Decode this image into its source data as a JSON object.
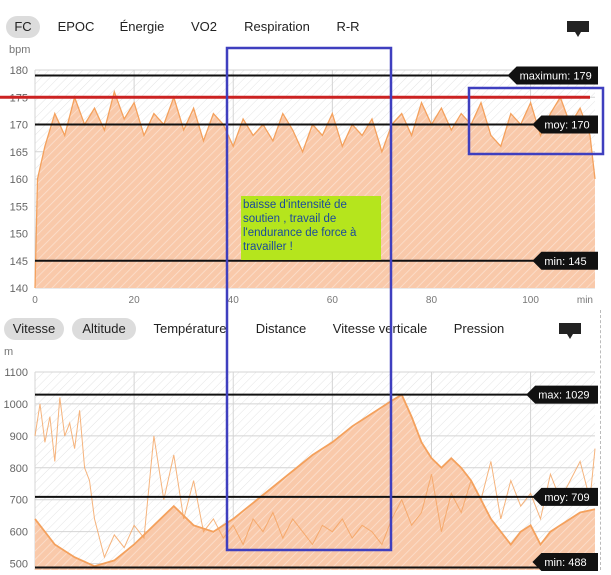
{
  "top_tabs": [
    {
      "label": "FC",
      "active": true
    },
    {
      "label": "EPOC",
      "active": false
    },
    {
      "label": "Énergie",
      "active": false
    },
    {
      "label": "VO2",
      "active": false
    },
    {
      "label": "Respiration",
      "active": false
    },
    {
      "label": "R-R",
      "active": false
    }
  ],
  "bottom_tabs": [
    {
      "label": "Vitesse",
      "active": true
    },
    {
      "label": "Altitude",
      "active": true
    },
    {
      "label": "Température",
      "active": false
    },
    {
      "label": "Distance",
      "active": false
    },
    {
      "label": "Vitesse verticale",
      "active": false
    },
    {
      "label": "Pression",
      "active": false
    }
  ],
  "annotation_note": {
    "lines": [
      "  baisse d'intensité de",
      "soutien ,  travail de",
      "l'endurance de force à",
      "travailler !"
    ]
  },
  "colors": {
    "area_fill": "#f9c9aa",
    "series_line": "#f4a15d",
    "reference_line": "#cc2222",
    "highlight_box": "#3f3fbf",
    "note_bg": "#b5e51d"
  },
  "chart_data": [
    {
      "type": "area",
      "ylabel": "bpm",
      "y_ticks": [
        140,
        145,
        150,
        155,
        160,
        165,
        170,
        175,
        180
      ],
      "x_ticks": [
        "0",
        "20",
        "40",
        "60",
        "80",
        "100"
      ],
      "x_unit": "min",
      "ylim": [
        140,
        180
      ],
      "xlim": [
        0,
        113
      ],
      "grid": true,
      "reference_line": 175,
      "stats": [
        {
          "label": "maximum: 179",
          "value": 179
        },
        {
          "label": "moy: 170",
          "value": 170
        },
        {
          "label": "min: 145",
          "value": 145
        }
      ],
      "series": [
        {
          "x": [
            0,
            0.5,
            2,
            4,
            6,
            8,
            10,
            12,
            14,
            16,
            18,
            20,
            22,
            24,
            26,
            28,
            30,
            32,
            34,
            36,
            38,
            40,
            42,
            44,
            46,
            48,
            50,
            52,
            54,
            56,
            58,
            60,
            62,
            64,
            66,
            68,
            70,
            72,
            74,
            76,
            78,
            80,
            82,
            84,
            86,
            88,
            90,
            92,
            94,
            96,
            98,
            100,
            102,
            104,
            106,
            108,
            110,
            112,
            113
          ],
          "y": [
            140,
            160,
            166,
            172,
            168,
            175,
            170,
            173,
            169,
            176,
            171,
            174,
            168,
            172,
            170,
            175,
            169,
            173,
            167,
            172,
            170,
            166,
            171,
            168,
            170,
            167,
            172,
            169,
            165,
            170,
            168,
            172,
            166,
            170,
            168,
            171,
            165,
            170,
            172,
            168,
            174,
            170,
            173,
            169,
            172,
            170,
            174,
            168,
            166,
            172,
            170,
            174,
            168,
            172,
            175,
            170,
            173,
            168,
            160
          ]
        }
      ]
    },
    {
      "type": "area",
      "ylabel": "m",
      "y_ticks": [
        500,
        600,
        700,
        800,
        900,
        1000,
        1100
      ],
      "ylim": [
        480,
        1100
      ],
      "xlim": [
        0,
        113
      ],
      "grid": true,
      "stats": [
        {
          "label": "max: 1029",
          "value": 1029
        },
        {
          "label": "moy: 709",
          "value": 709
        },
        {
          "label": "min: 488",
          "value": 488
        }
      ],
      "series": [
        {
          "name": "Altitude",
          "x": [
            0,
            4,
            8,
            12,
            16,
            20,
            24,
            28,
            32,
            36,
            40,
            44,
            48,
            52,
            56,
            60,
            64,
            68,
            72,
            74,
            76,
            78,
            80,
            82,
            84,
            86,
            88,
            90,
            92,
            94,
            96,
            98,
            100,
            102,
            104,
            106,
            108,
            110,
            113
          ],
          "y": [
            640,
            560,
            520,
            492,
            510,
            560,
            620,
            680,
            620,
            600,
            640,
            690,
            740,
            790,
            840,
            880,
            930,
            970,
            1010,
            1029,
            960,
            880,
            830,
            800,
            830,
            800,
            760,
            700,
            640,
            600,
            560,
            600,
            620,
            560,
            600,
            620,
            640,
            660,
            670
          ]
        },
        {
          "name": "Vitesse",
          "x": [
            0,
            1,
            2,
            3,
            4,
            5,
            6,
            7,
            8,
            9,
            10,
            11,
            12,
            14,
            16,
            18,
            20,
            22,
            24,
            26,
            28,
            30,
            32,
            34,
            36,
            38,
            40,
            42,
            44,
            46,
            48,
            50,
            52,
            54,
            56,
            58,
            60,
            62,
            64,
            66,
            68,
            70,
            72,
            74,
            76,
            78,
            80,
            82,
            84,
            86,
            88,
            90,
            92,
            94,
            96,
            98,
            100,
            102,
            104,
            106,
            108,
            110,
            112,
            113
          ],
          "y": [
            900,
            1000,
            880,
            960,
            820,
            1020,
            900,
            940,
            860,
            980,
            800,
            760,
            640,
            520,
            590,
            550,
            620,
            580,
            900,
            700,
            840,
            640,
            760,
            600,
            640,
            580,
            620,
            560,
            640,
            600,
            660,
            580,
            640,
            600,
            560,
            620,
            600,
            640,
            580,
            620,
            600,
            560,
            640,
            700,
            620,
            660,
            780,
            600,
            720,
            660,
            760,
            700,
            820,
            640,
            760,
            680,
            720,
            640,
            780,
            700,
            760,
            820,
            700,
            860
          ]
        }
      ]
    }
  ]
}
